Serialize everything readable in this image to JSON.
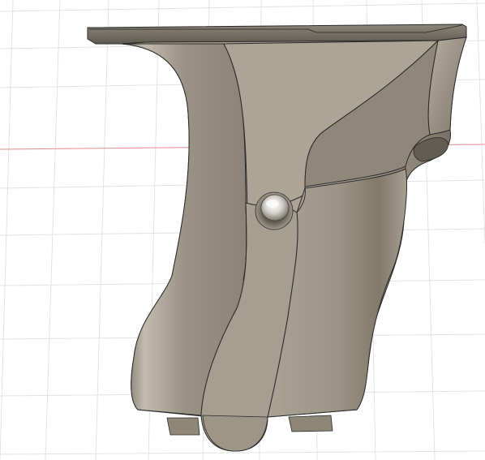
{
  "app": {
    "view": "3d-model-viewport",
    "model_name": ""
  },
  "colors": {
    "background": "#ffffff",
    "grid_line": "#e2e2e2",
    "grid_line_major": "#d6d6d6",
    "axis_red": "#e58c8c",
    "model_base": "#a39b8c",
    "model_light": "#c5bfb3",
    "model_dark": "#7a7366",
    "edge": "#2b2b2b"
  },
  "model": {
    "parts": [
      "top-rail",
      "grip-body",
      "left-panel",
      "right-panel",
      "screw-head",
      "bottom-tab-left",
      "bottom-tab-center",
      "bottom-tab-right"
    ]
  }
}
